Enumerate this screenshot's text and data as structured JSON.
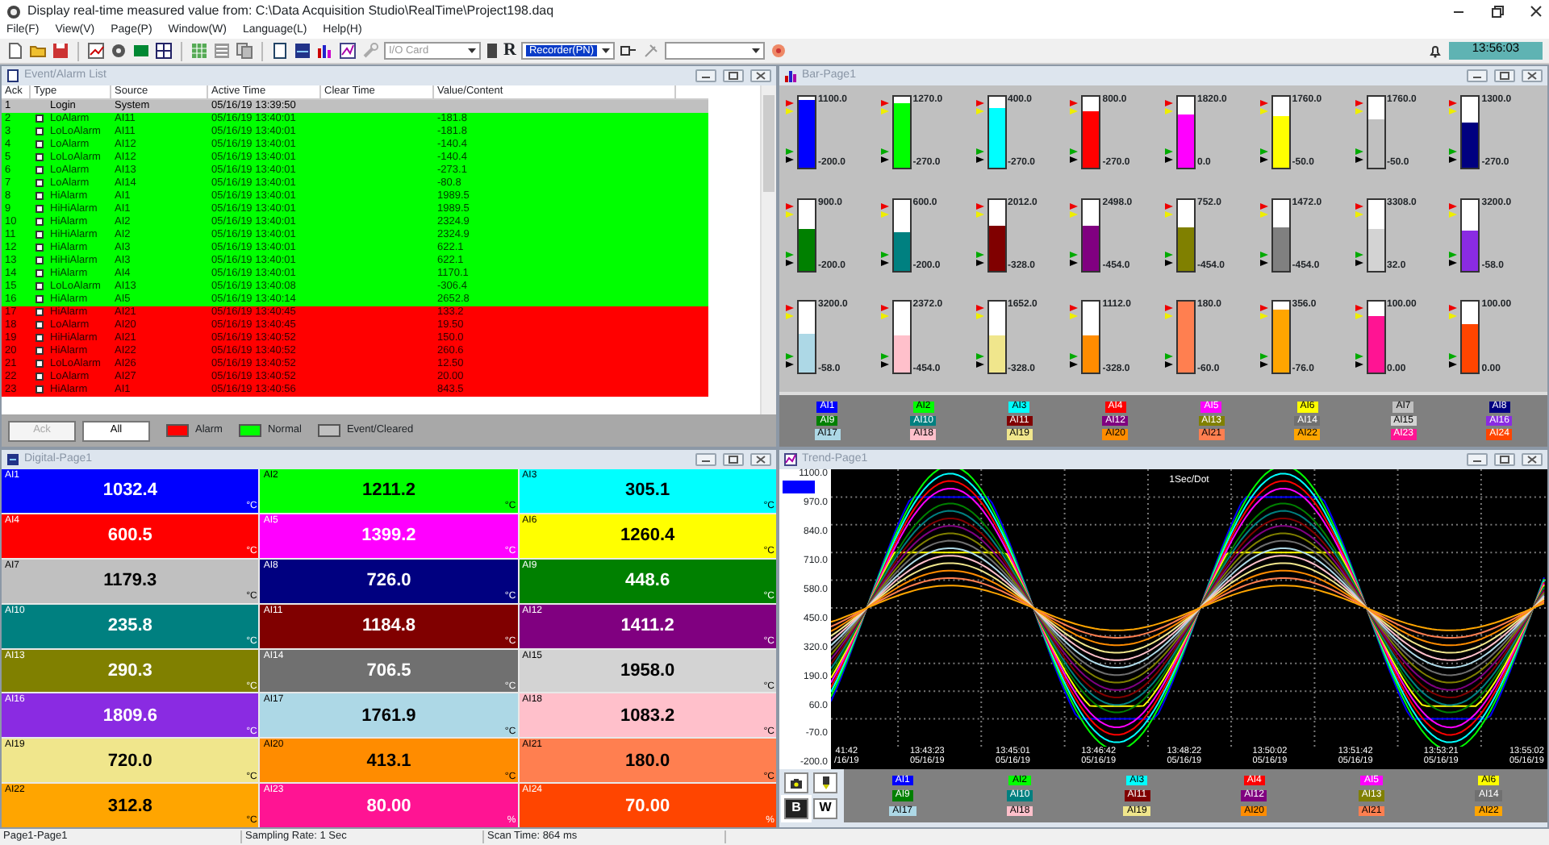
{
  "window": {
    "title": "Display real-time measured value from: C:\\Data Acquisition Studio\\RealTime\\Project198.daq"
  },
  "menu": [
    "File(F)",
    "View(V)",
    "Page(P)",
    "Window(W)",
    "Language(L)",
    "Help(H)"
  ],
  "toolbar": {
    "io_card": {
      "value": "I/O Card",
      "disabled": true
    },
    "recorder_mark": "R",
    "recorder": "Recorder(PN)",
    "clock": "13:56:03"
  },
  "event_list": {
    "title": "Event/Alarm List",
    "columns": [
      "Ack",
      "Type",
      "Source",
      "Active Time",
      "Clear Time",
      "Value/Content"
    ],
    "rows": [
      {
        "no": "1",
        "kind": "event",
        "type": "Login",
        "source": "System",
        "active": "05/16/19 13:39:50"
      },
      {
        "no": "2",
        "kind": "normal",
        "checked": false,
        "type": "LoAlarm",
        "source": "AI11",
        "active": "05/16/19 13:40:01",
        "value": "-181.8"
      },
      {
        "no": "3",
        "kind": "normal",
        "checked": false,
        "type": "LoLoAlarm",
        "source": "AI11",
        "active": "05/16/19 13:40:01",
        "value": "-181.8"
      },
      {
        "no": "4",
        "kind": "normal",
        "checked": false,
        "type": "LoAlarm",
        "source": "AI12",
        "active": "05/16/19 13:40:01",
        "value": "-140.4"
      },
      {
        "no": "5",
        "kind": "normal",
        "checked": false,
        "type": "LoLoAlarm",
        "source": "AI12",
        "active": "05/16/19 13:40:01",
        "value": "-140.4"
      },
      {
        "no": "6",
        "kind": "normal",
        "checked": false,
        "type": "LoAlarm",
        "source": "AI13",
        "active": "05/16/19 13:40:01",
        "value": "-273.1"
      },
      {
        "no": "7",
        "kind": "normal",
        "checked": false,
        "type": "LoAlarm",
        "source": "AI14",
        "active": "05/16/19 13:40:01",
        "value": "-80.8"
      },
      {
        "no": "8",
        "kind": "normal",
        "checked": false,
        "type": "HiAlarm",
        "source": "AI1",
        "active": "05/16/19 13:40:01",
        "value": "1989.5"
      },
      {
        "no": "9",
        "kind": "normal",
        "checked": false,
        "type": "HiHiAlarm",
        "source": "AI1",
        "active": "05/16/19 13:40:01",
        "value": "1989.5"
      },
      {
        "no": "10",
        "kind": "normal",
        "checked": false,
        "type": "HiAlarm",
        "source": "AI2",
        "active": "05/16/19 13:40:01",
        "value": "2324.9"
      },
      {
        "no": "11",
        "kind": "normal",
        "checked": false,
        "type": "HiHiAlarm",
        "source": "AI2",
        "active": "05/16/19 13:40:01",
        "value": "2324.9"
      },
      {
        "no": "12",
        "kind": "normal",
        "checked": false,
        "type": "HiAlarm",
        "source": "AI3",
        "active": "05/16/19 13:40:01",
        "value": "622.1"
      },
      {
        "no": "13",
        "kind": "normal",
        "checked": false,
        "type": "HiHiAlarm",
        "source": "AI3",
        "active": "05/16/19 13:40:01",
        "value": "622.1"
      },
      {
        "no": "14",
        "kind": "normal",
        "checked": false,
        "type": "HiAlarm",
        "source": "AI4",
        "active": "05/16/19 13:40:01",
        "value": "1170.1"
      },
      {
        "no": "15",
        "kind": "normal",
        "checked": false,
        "type": "LoLoAlarm",
        "source": "AI13",
        "active": "05/16/19 13:40:08",
        "value": "-306.4"
      },
      {
        "no": "16",
        "kind": "normal",
        "checked": false,
        "type": "HiAlarm",
        "source": "AI5",
        "active": "05/16/19 13:40:14",
        "value": "2652.8"
      },
      {
        "no": "17",
        "kind": "alarm",
        "checked": false,
        "type": "HiAlarm",
        "source": "AI21",
        "active": "05/16/19 13:40:45",
        "value": "133.2"
      },
      {
        "no": "18",
        "kind": "alarm",
        "checked": false,
        "type": "LoAlarm",
        "source": "AI20",
        "active": "05/16/19 13:40:45",
        "value": "19.50"
      },
      {
        "no": "19",
        "kind": "alarm",
        "checked": false,
        "type": "HiHiAlarm",
        "source": "AI21",
        "active": "05/16/19 13:40:52",
        "value": "150.0"
      },
      {
        "no": "20",
        "kind": "alarm",
        "checked": false,
        "type": "HiAlarm",
        "source": "AI22",
        "active": "05/16/19 13:40:52",
        "value": "260.6"
      },
      {
        "no": "21",
        "kind": "alarm",
        "checked": false,
        "type": "LoLoAlarm",
        "source": "AI26",
        "active": "05/16/19 13:40:52",
        "value": "12.50"
      },
      {
        "no": "22",
        "kind": "alarm",
        "checked": false,
        "type": "LoAlarm",
        "source": "AI27",
        "active": "05/16/19 13:40:52",
        "value": "20.00"
      },
      {
        "no": "23",
        "kind": "alarm",
        "checked": false,
        "type": "HiAlarm",
        "source": "AI1",
        "active": "05/16/19 13:40:56",
        "value": "843.5"
      }
    ],
    "ack": {
      "label": "Ack",
      "disabled": true
    },
    "all": "All",
    "legend": [
      {
        "label": "Alarm",
        "color": "#ff0000"
      },
      {
        "label": "Normal",
        "color": "#00ff00"
      },
      {
        "label": "Event/Cleared",
        "color": "#c0c0c0"
      }
    ]
  },
  "bar_page": {
    "title": "Bar-Page1",
    "bars": [
      {
        "max": "1100.0",
        "min": "-200.0",
        "color": "#0000ff",
        "level": 0.95
      },
      {
        "max": "1270.0",
        "min": "-270.0",
        "color": "#00ff00",
        "level": 0.9
      },
      {
        "max": "400.0",
        "min": "-270.0",
        "color": "#00ffff",
        "level": 0.85
      },
      {
        "max": "800.0",
        "min": "-270.0",
        "color": "#ff0000",
        "level": 0.8
      },
      {
        "max": "1820.0",
        "min": "0.0",
        "color": "#ff00ff",
        "level": 0.76
      },
      {
        "max": "1760.0",
        "min": "-50.0",
        "color": "#ffff00",
        "level": 0.72
      },
      {
        "max": "1760.0",
        "min": "-50.0",
        "color": "#c0c0c0",
        "level": 0.68
      },
      {
        "max": "1300.0",
        "min": "-270.0",
        "color": "#000080",
        "level": 0.64
      },
      {
        "max": "900.0",
        "min": "-200.0",
        "color": "#008000",
        "level": 0.58
      },
      {
        "max": "600.0",
        "min": "-200.0",
        "color": "#008080",
        "level": 0.54
      },
      {
        "max": "2012.0",
        "min": "-328.0",
        "color": "#800000",
        "level": 0.64
      },
      {
        "max": "2498.0",
        "min": "-454.0",
        "color": "#800080",
        "level": 0.62
      },
      {
        "max": "752.0",
        "min": "-454.0",
        "color": "#808000",
        "level": 0.6
      },
      {
        "max": "1472.0",
        "min": "-454.0",
        "color": "#808080",
        "level": 0.6
      },
      {
        "max": "3308.0",
        "min": "32.0",
        "color": "#d3d3d3",
        "level": 0.58
      },
      {
        "max": "3200.0",
        "min": "-58.0",
        "color": "#8a2be2",
        "level": 0.55
      },
      {
        "max": "3200.0",
        "min": "-58.0",
        "color": "#add8e6",
        "level": 0.55
      },
      {
        "max": "2372.0",
        "min": "-454.0",
        "color": "#ffc0cb",
        "level": 0.52
      },
      {
        "max": "1652.0",
        "min": "-328.0",
        "color": "#f0e68c",
        "level": 0.52
      },
      {
        "max": "1112.0",
        "min": "-328.0",
        "color": "#ff8c00",
        "level": 0.52
      },
      {
        "max": "180.0",
        "min": "-60.0",
        "color": "#ff7f50",
        "level": 1.0
      },
      {
        "max": "356.0",
        "min": "-76.0",
        "color": "#ffa500",
        "level": 0.9
      },
      {
        "max": "100.00",
        "min": "0.00",
        "color": "#ff1493",
        "level": 0.8
      },
      {
        "max": "100.00",
        "min": "0.00",
        "color": "#ff4500",
        "level": 0.7
      }
    ],
    "legend": [
      {
        "label": "AI1",
        "color": "#0000ff"
      },
      {
        "label": "AI2",
        "color": "#00ff00"
      },
      {
        "label": "AI3",
        "color": "#00ffff"
      },
      {
        "label": "AI4",
        "color": "#ff0000"
      },
      {
        "label": "AI5",
        "color": "#ff00ff"
      },
      {
        "label": "AI6",
        "color": "#ffff00"
      },
      {
        "label": "AI7",
        "color": "#c0c0c0"
      },
      {
        "label": "AI8",
        "color": "#000080"
      },
      {
        "label": "AI9",
        "color": "#008000"
      },
      {
        "label": "AI10",
        "color": "#008080"
      },
      {
        "label": "AI11",
        "color": "#800000"
      },
      {
        "label": "AI12",
        "color": "#800080"
      },
      {
        "label": "AI13",
        "color": "#808000"
      },
      {
        "label": "AI14",
        "color": "#707070"
      },
      {
        "label": "AI15",
        "color": "#d3d3d3"
      },
      {
        "label": "AI16",
        "color": "#8a2be2"
      },
      {
        "label": "AI17",
        "color": "#add8e6"
      },
      {
        "label": "AI18",
        "color": "#ffc0cb"
      },
      {
        "label": "AI19",
        "color": "#f0e68c"
      },
      {
        "label": "AI20",
        "color": "#ff8c00"
      },
      {
        "label": "AI21",
        "color": "#ff7f50"
      },
      {
        "label": "AI22",
        "color": "#ffa500"
      },
      {
        "label": "AI23",
        "color": "#ff1493"
      },
      {
        "label": "AI24",
        "color": "#ff4500"
      }
    ]
  },
  "digital_page": {
    "title": "Digital-Page1",
    "tiles": [
      {
        "label": "AI1",
        "value": "1032.4",
        "unit": "°C",
        "color": "#0000ff"
      },
      {
        "label": "AI2",
        "value": "1211.2",
        "unit": "°C",
        "color": "#00ff00"
      },
      {
        "label": "AI3",
        "value": "305.1",
        "unit": "°C",
        "color": "#00ffff"
      },
      {
        "label": "AI4",
        "value": "600.5",
        "unit": "°C",
        "color": "#ff0000"
      },
      {
        "label": "AI5",
        "value": "1399.2",
        "unit": "°C",
        "color": "#ff00ff"
      },
      {
        "label": "AI6",
        "value": "1260.4",
        "unit": "°C",
        "color": "#ffff00"
      },
      {
        "label": "AI7",
        "value": "1179.3",
        "unit": "°C",
        "color": "#c0c0c0"
      },
      {
        "label": "AI8",
        "value": "726.0",
        "unit": "°C",
        "color": "#000080"
      },
      {
        "label": "AI9",
        "value": "448.6",
        "unit": "°C",
        "color": "#008000"
      },
      {
        "label": "AI10",
        "value": "235.8",
        "unit": "°C",
        "color": "#008080"
      },
      {
        "label": "AI11",
        "value": "1184.8",
        "unit": "°C",
        "color": "#800000"
      },
      {
        "label": "AI12",
        "value": "1411.2",
        "unit": "°C",
        "color": "#800080"
      },
      {
        "label": "AI13",
        "value": "290.3",
        "unit": "°C",
        "color": "#808000"
      },
      {
        "label": "AI14",
        "value": "706.5",
        "unit": "°C",
        "color": "#707070"
      },
      {
        "label": "AI15",
        "value": "1958.0",
        "unit": "°C",
        "color": "#d3d3d3"
      },
      {
        "label": "AI16",
        "value": "1809.6",
        "unit": "°C",
        "color": "#8a2be2"
      },
      {
        "label": "AI17",
        "value": "1761.9",
        "unit": "°C",
        "color": "#add8e6"
      },
      {
        "label": "AI18",
        "value": "1083.2",
        "unit": "°C",
        "color": "#ffc0cb"
      },
      {
        "label": "AI19",
        "value": "720.0",
        "unit": "°C",
        "color": "#f0e68c"
      },
      {
        "label": "AI20",
        "value": "413.1",
        "unit": "°C",
        "color": "#ff8c00"
      },
      {
        "label": "AI21",
        "value": "180.0",
        "unit": "°C",
        "color": "#ff7f50"
      },
      {
        "label": "AI22",
        "value": "312.8",
        "unit": "°C",
        "color": "#ffa500"
      },
      {
        "label": "AI23",
        "value": "80.00",
        "unit": "%",
        "color": "#ff1493"
      },
      {
        "label": "AI24",
        "value": "70.00",
        "unit": "%",
        "color": "#ff4500"
      }
    ]
  },
  "trend_page": {
    "title": "Trend-Page1",
    "scale": "1Sec/Dot",
    "y_labels": [
      "1100.0",
      "970.0",
      "840.0",
      "710.0",
      "580.0",
      "450.0",
      "320.0",
      "190.0",
      "60.0",
      "-70.0",
      "-200.0"
    ],
    "x_labels": [
      {
        "time": "41:42",
        "date": "/16/19"
      },
      {
        "time": "13:43:23",
        "date": "05/16/19"
      },
      {
        "time": "13:45:01",
        "date": "05/16/19"
      },
      {
        "time": "13:46:42",
        "date": "05/16/19"
      },
      {
        "time": "13:48:22",
        "date": "05/16/19"
      },
      {
        "time": "13:50:02",
        "date": "05/16/19"
      },
      {
        "time": "13:51:42",
        "date": "05/16/19"
      },
      {
        "time": "13:53:21",
        "date": "05/16/19"
      },
      {
        "time": "13:55:02",
        "date": "05/16/19"
      }
    ],
    "legend": [
      {
        "label": "AI1",
        "color": "#0000ff"
      },
      {
        "label": "AI2",
        "color": "#00ff00"
      },
      {
        "label": "AI3",
        "color": "#00ffff"
      },
      {
        "label": "AI4",
        "color": "#ff0000"
      },
      {
        "label": "AI5",
        "color": "#ff00ff"
      },
      {
        "label": "AI6",
        "color": "#ffff00"
      },
      {
        "label": "AI9",
        "color": "#008000"
      },
      {
        "label": "AI10",
        "color": "#008080"
      },
      {
        "label": "AI11",
        "color": "#800000"
      },
      {
        "label": "AI12",
        "color": "#800080"
      },
      {
        "label": "AI13",
        "color": "#808000"
      },
      {
        "label": "AI14",
        "color": "#707070"
      },
      {
        "label": "AI17",
        "color": "#add8e6"
      },
      {
        "label": "AI18",
        "color": "#ffc0cb"
      },
      {
        "label": "AI19",
        "color": "#f0e68c"
      },
      {
        "label": "AI20",
        "color": "#ff8c00"
      },
      {
        "label": "AI21",
        "color": "#ff7f50"
      },
      {
        "label": "AI22",
        "color": "#ffa500"
      }
    ],
    "buttons": [
      "B",
      "W"
    ]
  },
  "status_bar": [
    "Page1-Page1",
    "Sampling Rate: 1 Sec",
    "Scan Time: 864 ms"
  ]
}
